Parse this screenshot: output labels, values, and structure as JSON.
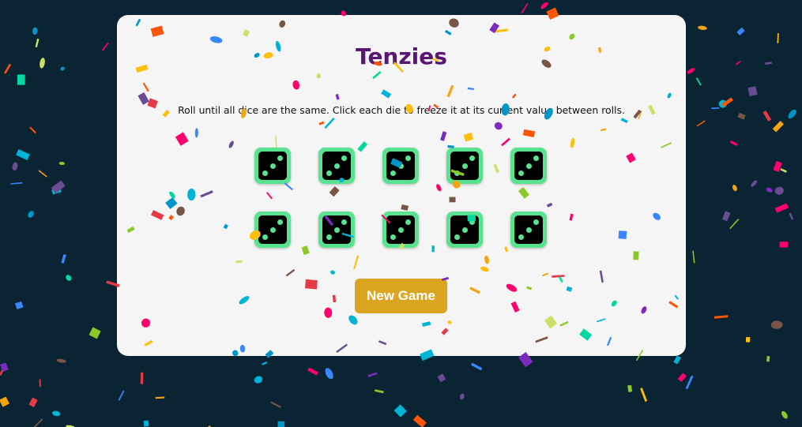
{
  "app": {
    "title": "Tenzies",
    "instructions": "Roll until all dice are the same. Click each die to freeze it at its current value between rolls.",
    "new_game_label": "New Game"
  },
  "dice": [
    {
      "value": 3,
      "held": true
    },
    {
      "value": 3,
      "held": true
    },
    {
      "value": 3,
      "held": true
    },
    {
      "value": 3,
      "held": true
    },
    {
      "value": 3,
      "held": true
    },
    {
      "value": 3,
      "held": true
    },
    {
      "value": 3,
      "held": true
    },
    {
      "value": 3,
      "held": true
    },
    {
      "value": 3,
      "held": true
    },
    {
      "value": 3,
      "held": true
    }
  ],
  "colors": {
    "background": "#0b2434",
    "card": "#f5f5f5",
    "title": "#5a1675",
    "die_held": "#59e391",
    "die_face": "#000000",
    "button": "#dba521"
  },
  "confetti_palette": [
    "#f4a40c",
    "#e63946",
    "#3a86ff",
    "#7b2cbf",
    "#00b4d8",
    "#8ac926",
    "#ffbe0b",
    "#ff006e",
    "#06d6a0",
    "#fb5607",
    "#6a4c93",
    "#c9e265",
    "#795548",
    "#0096c7"
  ]
}
